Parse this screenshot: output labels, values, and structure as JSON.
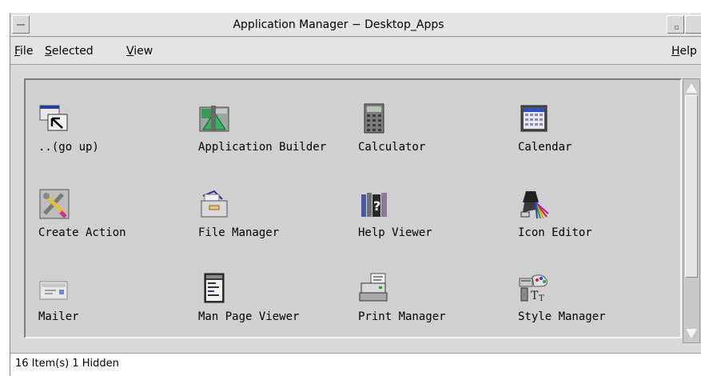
{
  "window": {
    "title": "Application Manager − Desktop_Apps"
  },
  "menubar": {
    "file": {
      "mnemonic": "F",
      "rest": "ile"
    },
    "selected": {
      "mnemonic": "S",
      "rest": "elected"
    },
    "view": {
      "mnemonic": "V",
      "rest": "iew"
    },
    "help": {
      "mnemonic": "H",
      "rest": "elp"
    }
  },
  "apps": [
    {
      "label": "..(go up)",
      "icon": "folder-up-icon"
    },
    {
      "label": "Application Builder",
      "icon": "app-builder-icon"
    },
    {
      "label": "Calculator",
      "icon": "calculator-icon"
    },
    {
      "label": "Calendar",
      "icon": "calendar-icon"
    },
    {
      "label": "Create Action",
      "icon": "create-action-icon"
    },
    {
      "label": "File Manager",
      "icon": "file-manager-icon"
    },
    {
      "label": "Help Viewer",
      "icon": "help-viewer-icon"
    },
    {
      "label": "Icon Editor",
      "icon": "icon-editor-icon"
    },
    {
      "label": "Mailer",
      "icon": "mailer-icon"
    },
    {
      "label": "Man Page Viewer",
      "icon": "man-page-icon"
    },
    {
      "label": "Print Manager",
      "icon": "printer-icon"
    },
    {
      "label": "Style Manager",
      "icon": "style-manager-icon"
    }
  ],
  "status": {
    "text": "16 Item(s) 1 Hidden"
  },
  "colors": {
    "window_bg": "#d9d9d9",
    "content_bg": "#d0d0d0"
  }
}
